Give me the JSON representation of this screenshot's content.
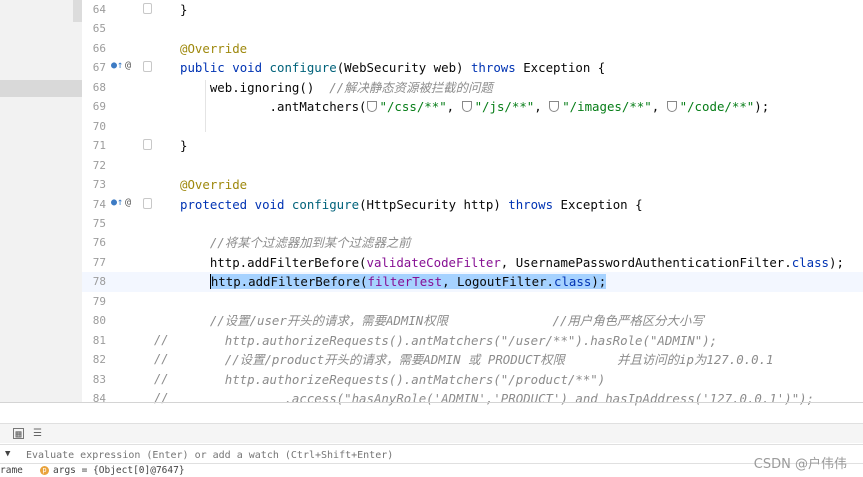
{
  "editor": {
    "lines": [
      {
        "n": "64",
        "markers": false,
        "comment_prefix": "",
        "current": false
      },
      {
        "n": "65",
        "markers": false,
        "comment_prefix": "",
        "current": false
      },
      {
        "n": "66",
        "markers": false,
        "comment_prefix": "",
        "current": false
      },
      {
        "n": "67",
        "markers": true,
        "comment_prefix": "",
        "current": false
      },
      {
        "n": "68",
        "markers": false,
        "comment_prefix": "",
        "current": false
      },
      {
        "n": "69",
        "markers": false,
        "comment_prefix": "",
        "current": false
      },
      {
        "n": "70",
        "markers": false,
        "comment_prefix": "",
        "current": false
      },
      {
        "n": "71",
        "markers": false,
        "comment_prefix": "",
        "current": false
      },
      {
        "n": "72",
        "markers": false,
        "comment_prefix": "",
        "current": false
      },
      {
        "n": "73",
        "markers": false,
        "comment_prefix": "",
        "current": false
      },
      {
        "n": "74",
        "markers": true,
        "comment_prefix": "",
        "current": false
      },
      {
        "n": "75",
        "markers": false,
        "comment_prefix": "",
        "current": false
      },
      {
        "n": "76",
        "markers": false,
        "comment_prefix": "",
        "current": false
      },
      {
        "n": "77",
        "markers": false,
        "comment_prefix": "",
        "current": false
      },
      {
        "n": "78",
        "markers": false,
        "comment_prefix": "",
        "current": true
      },
      {
        "n": "79",
        "markers": false,
        "comment_prefix": "",
        "current": false
      },
      {
        "n": "80",
        "markers": false,
        "comment_prefix": "",
        "current": false
      },
      {
        "n": "81",
        "markers": false,
        "comment_prefix": "//",
        "current": false
      },
      {
        "n": "82",
        "markers": false,
        "comment_prefix": "//",
        "current": false
      },
      {
        "n": "83",
        "markers": false,
        "comment_prefix": "//",
        "current": false
      },
      {
        "n": "84",
        "markers": false,
        "comment_prefix": "//",
        "current": false
      }
    ],
    "code": {
      "l64_brace": "}",
      "l66_override": "@Override",
      "l67_public": "public",
      "l67_void": "void",
      "l67_name": "configure",
      "l67_params": "(WebSecurity web) ",
      "l67_throws": "throws",
      "l67_exc": " Exception {",
      "l68_call": "web.ignoring()  ",
      "l68_comment": "//解决静态资源被拦截的问题",
      "l69_method": ".antMatchers(",
      "l69_s1": "\"/css/**\"",
      "l69_s2": "\"/js/**\"",
      "l69_s3": "\"/images/**\"",
      "l69_s4": "\"/code/**\"",
      "l69_sep": ", ",
      "l69_end": ");",
      "l71_brace": "}",
      "l73_override": "@Override",
      "l74_protected": "protected",
      "l74_void": "void",
      "l74_name": "configure",
      "l74_params": "(HttpSecurity http) ",
      "l74_throws": "throws",
      "l74_exc": " Exception {",
      "l76_comment": "//将某个过滤器加到某个过滤器之前",
      "l77_call": "http.addFilterBefore(",
      "l77_field": "validateCodeFilter",
      "l77_mid": ", UsernamePasswordAuthenticationFilter.",
      "l77_class": "class",
      "l77_end": ");",
      "l78_call": "http.addFilterBefore(",
      "l78_field": "filterTest",
      "l78_mid": ", LogoutFilter.",
      "l78_class": "class",
      "l78_end": ");",
      "l80_comment1": "//设置/user开头的请求，需要ADMIN权限",
      "l80_comment2": "//用户角色严格区分大小写",
      "l81_text": "http.authorizeRequests().antMatchers(\"/user/**\").hasRole(\"ADMIN\");",
      "l82_text": "//设置/product开头的请求，需要ADMIN 或 PRODUCT权限       并且访问的ip为127.0.0.1",
      "l83_text": "http.authorizeRequests().antMatchers(\"/product/**\")",
      "l84_text": ".access(\"hasAnyRole('ADMIN','PRODUCT') and hasIpAddress('127.0.0.1')\");"
    }
  },
  "debugger": {
    "eval_placeholder": "Evaluate expression (Enter) or add a watch (Ctrl+Shift+Enter)",
    "frame_label": "rame",
    "var_icon_letter": "p",
    "var_text": "args = {Object[0]@7647}"
  },
  "watermark": "CSDN @户伟伟",
  "icons": [
    "grid-icon",
    "lines-icon",
    "expand-caret-icon",
    "override-icon",
    "annotation-icon",
    "fold-icon",
    "shield-icon",
    "parameter-icon"
  ]
}
